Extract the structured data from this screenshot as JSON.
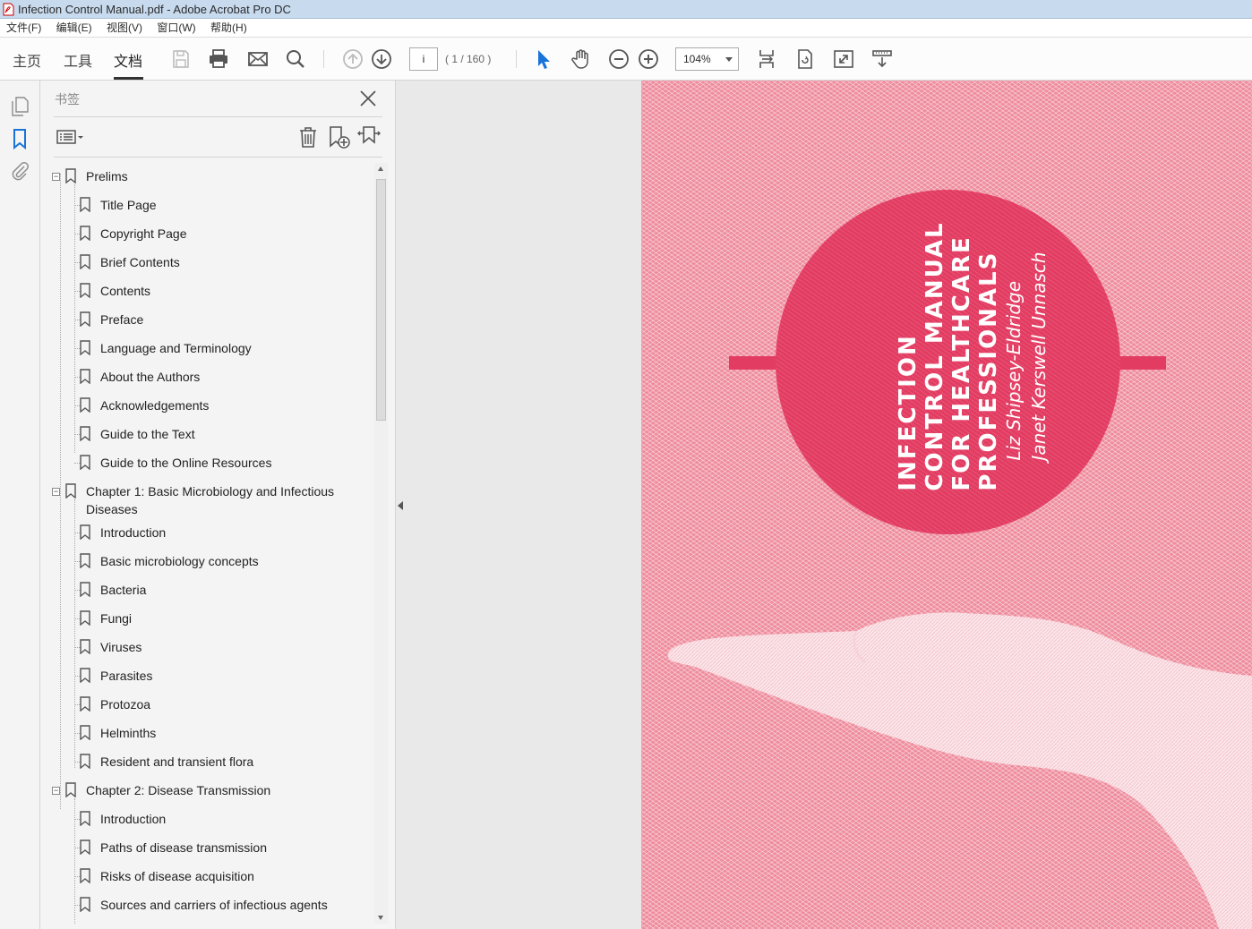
{
  "window": {
    "title": "Infection Control Manual.pdf - Adobe Acrobat Pro DC"
  },
  "menu": [
    "文件(F)",
    "编辑(E)",
    "视图(V)",
    "窗口(W)",
    "帮助(H)"
  ],
  "tabs": {
    "home": "主页",
    "tools": "工具",
    "document": "文档"
  },
  "nav": {
    "page_value": "i",
    "page_count": "( 1 / 160 )"
  },
  "zoom": {
    "value": "104%"
  },
  "panel": {
    "title": "书签"
  },
  "bookmarks": {
    "prelims": "Prelims",
    "title_page": "Title Page",
    "copyright": "Copyright Page",
    "brief_contents": "Brief Contents",
    "contents": "Contents",
    "preface": "Preface",
    "language": "Language and Terminology",
    "about": "About the Authors",
    "ack": "Acknowledgements",
    "guide_text": "Guide to the Text",
    "guide_online": "Guide to the Online Resources",
    "ch1": "Chapter 1: Basic Microbiology and Infectious",
    "ch1_cont": "Diseases",
    "ch1_intro": "Introduction",
    "ch1_basic": "Basic microbiology concepts",
    "ch1_bacteria": "Bacteria",
    "ch1_fungi": "Fungi",
    "ch1_viruses": "Viruses",
    "ch1_parasites": "Parasites",
    "ch1_protozoa": "Protozoa",
    "ch1_helminths": "Helminths",
    "ch1_flora": "Resident and transient flora",
    "ch2": "Chapter 2: Disease Transmission",
    "ch2_intro": "Introduction",
    "ch2_paths": "Paths of disease transmission",
    "ch2_risks": "Risks of disease acquisition",
    "ch2_sources": "Sources and carriers of infectious agents"
  },
  "cover": {
    "title_l1": "INFECTION",
    "title_l2": "CONTROL MANUAL",
    "title_l3": "FOR HEALTHCARE",
    "title_l4": "PROFESSIONALS",
    "author1": "Liz Shipsey-Eldridge",
    "author2": "Janet Kerswell Unnasch",
    "accent": "#e33c62",
    "background": "#ee8b9c"
  }
}
